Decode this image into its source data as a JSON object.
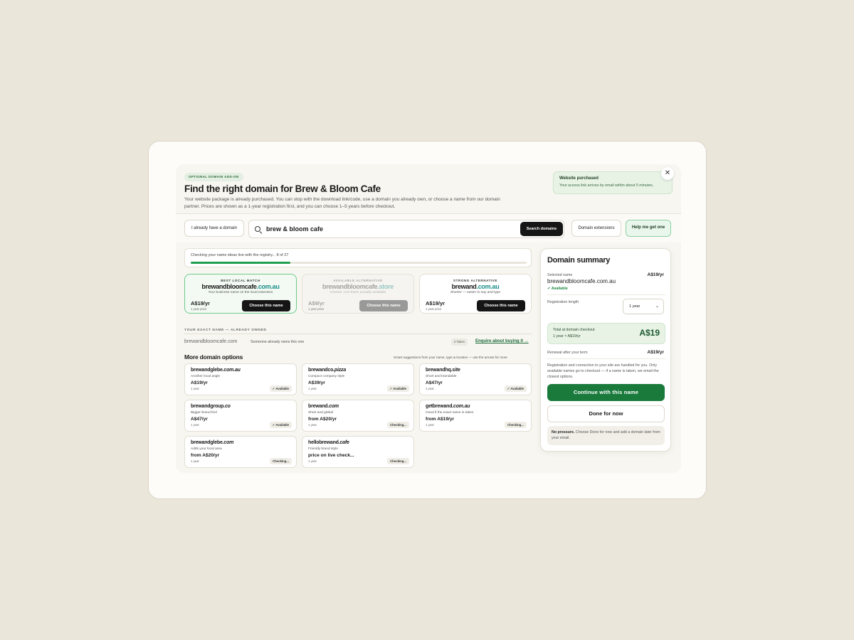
{
  "header": {
    "tag": "OPTIONAL DOMAIN ADD-ON",
    "title": "Find the right domain for Brew & Bloom Cafe",
    "subtitle": "Your website package is already purchased. You can stop with the download link/code, use a domain you already own, or choose a name from our domain partner. Prices are shown as a 1-year registration first, and you can choose 1–5 years before checkout."
  },
  "toast": {
    "title": "Website purchased",
    "message": "Your access link arrives by email within about 5 minutes."
  },
  "toolbar": {
    "have_domain": "I already have a domain",
    "search_query": "brew & bloom cafe",
    "search_button": "Search domains",
    "extensions_button": "Domain extensions",
    "help_button": "Help me get one"
  },
  "progress": {
    "label": "Checking your name ideas live with the registry...",
    "count": "8 of 27",
    "fraction": 0.296
  },
  "featured": [
    {
      "kicker": "BEST LOCAL MATCH",
      "name": "brewandbloomcafe",
      "tld": ".com.au",
      "desc": "Your business name on the local extension",
      "price": "A$19/yr",
      "term": "1 year price",
      "button": "Choose this name"
    },
    {
      "kicker": "AVAILABLE ALTERNATIVE",
      "name": "brewandbloomcafe",
      "tld": ".store",
      "desc": "Closest .com that's actually available",
      "price": "A$9/yr",
      "term": "1 year price",
      "button": "Choose this name"
    },
    {
      "kicker": "STRONG ALTERNATIVE",
      "name": "brewand",
      "tld": ".com.au",
      "desc": "Shorter — easier to say and type",
      "price": "A$19/yr",
      "term": "1 year price",
      "button": "Choose this name"
    }
  ],
  "owned": {
    "label": "YOUR EXACT NAME — ALREADY OWNED",
    "name": "brewandbloomcafe.com",
    "note": "Someone already owns this one",
    "tag": "2 Takes",
    "enquire": "Enquire about buying it →"
  },
  "more": {
    "title": "More domain options",
    "hint": "Smart suggestions from your name, type & location — use the arrows for more",
    "options": [
      {
        "name": "brewandglebe",
        "tld": ".com.au",
        "sub": "Another local angle",
        "price": "A$19/yr",
        "term": "1 year",
        "status": "✓ Available"
      },
      {
        "name": "brewandco",
        "tld": ".pizza",
        "sub": "Compact company style",
        "price": "A$39/yr",
        "term": "1 year",
        "status": "✓ Available"
      },
      {
        "name": "brewandhq",
        "tld": ".site",
        "sub": "Short and brandable",
        "price": "A$47/yr",
        "term": "1 year",
        "status": "✓ Available"
      },
      {
        "name": "brewandgroup",
        "tld": ".co",
        "sub": "Bigger-brand feel",
        "price": "A$47/yr",
        "term": "1 year",
        "status": "✓ Available"
      },
      {
        "name": "brewand",
        "tld": ".com",
        "sub": "Short and global",
        "price": "from A$20/yr",
        "term": "1 year",
        "status": "Checking..."
      },
      {
        "name": "getbrewand",
        "tld": ".com.au",
        "sub": "Good if the exact name is taken",
        "price": "from A$19/yr",
        "term": "1 year",
        "status": "Checking..."
      },
      {
        "name": "brewandglebe",
        "tld": ".com",
        "sub": "Adds your local area",
        "price": "from A$20/yr",
        "term": "1 year",
        "status": "Checking..."
      },
      {
        "name": "hellobrewand",
        "tld": ".cafe",
        "sub": "Friendly brand style",
        "price": "price on live check...",
        "term": "1 year",
        "status": "Checking..."
      }
    ]
  },
  "summary": {
    "title": "Domain summary",
    "selected_label": "Selected name",
    "selected_price": "A$19/yr",
    "selected_name": "brewandbloomcafe.com.au",
    "available": "✓ Available",
    "length_label": "Registration length",
    "length_value": "1 year",
    "total_label": "Total at domain checkout",
    "total_detail": "1 year × A$19/yr",
    "total_amount": "A$19",
    "renewal_label": "Renewal after your term",
    "renewal_price": "A$19/yr",
    "note": "Registration and connection to your site are handled for you. Only available names go to checkout — if a name is taken, we email the closest options.",
    "cta": "Continue with this name",
    "done": "Done for now",
    "pressure_bold": "No pressure.",
    "pressure_text": "Choose Done for now and add a domain later from your email."
  }
}
